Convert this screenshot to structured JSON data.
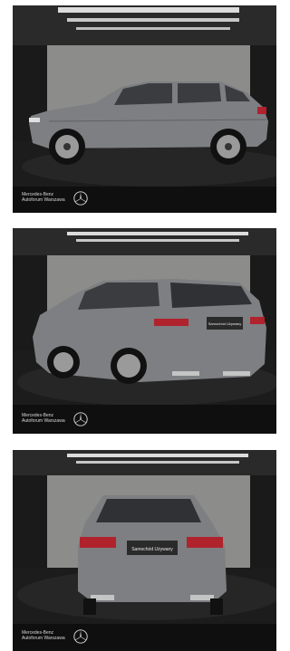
{
  "photos": [
    {
      "view": "side",
      "brand_line": "Mercedes-Benz",
      "dealer_line": "Autoforum Warszawa"
    },
    {
      "view": "rear-three-quarter",
      "brand_line": "Mercedes-Benz",
      "dealer_line": "Autoforum Warszawa",
      "plate_text": "Samochód Używany"
    },
    {
      "view": "rear",
      "brand_line": "Mercedes-Benz",
      "dealer_line": "Autoforum Warszawa",
      "plate_text": "Samochód Używany"
    }
  ],
  "colors": {
    "car_body": "#7d7f82",
    "backdrop": "#8c8c8a",
    "floor": "#1c1c1c",
    "taillight": "#b0222c"
  }
}
